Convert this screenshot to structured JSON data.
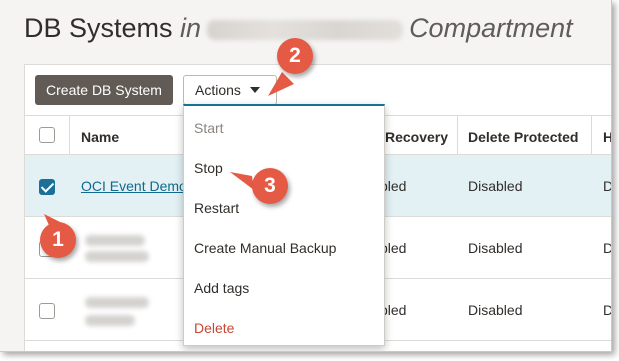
{
  "header": {
    "title_prefix": "DB Systems",
    "title_in": "in",
    "title_suffix": "Compartment"
  },
  "toolbar": {
    "create_label": "Create DB System",
    "actions_label": "Actions"
  },
  "table": {
    "headers": [
      "Name",
      "Recovery",
      "Delete Protected",
      "H"
    ],
    "rows": [
      {
        "name": "OCI Event Demo",
        "recovery": "bled",
        "delete_protected": "Disabled",
        "h": "D",
        "selected": true
      },
      {
        "name": "",
        "recovery": "bled",
        "delete_protected": "Disabled",
        "h": "D",
        "selected": false
      },
      {
        "name": "",
        "recovery": "bled",
        "delete_protected": "Disabled",
        "h": "D",
        "selected": false
      }
    ]
  },
  "actions_menu": {
    "items": [
      "Start",
      "Stop",
      "Restart",
      "Create Manual Backup",
      "Add tags",
      "Delete"
    ]
  },
  "callouts": [
    "1",
    "2",
    "3"
  ],
  "colors": {
    "accent": "#1c6f96",
    "callout": "#e45a45",
    "primary_button": "#625b55",
    "danger": "#c74634",
    "selected_row": "#e3f1f5"
  }
}
